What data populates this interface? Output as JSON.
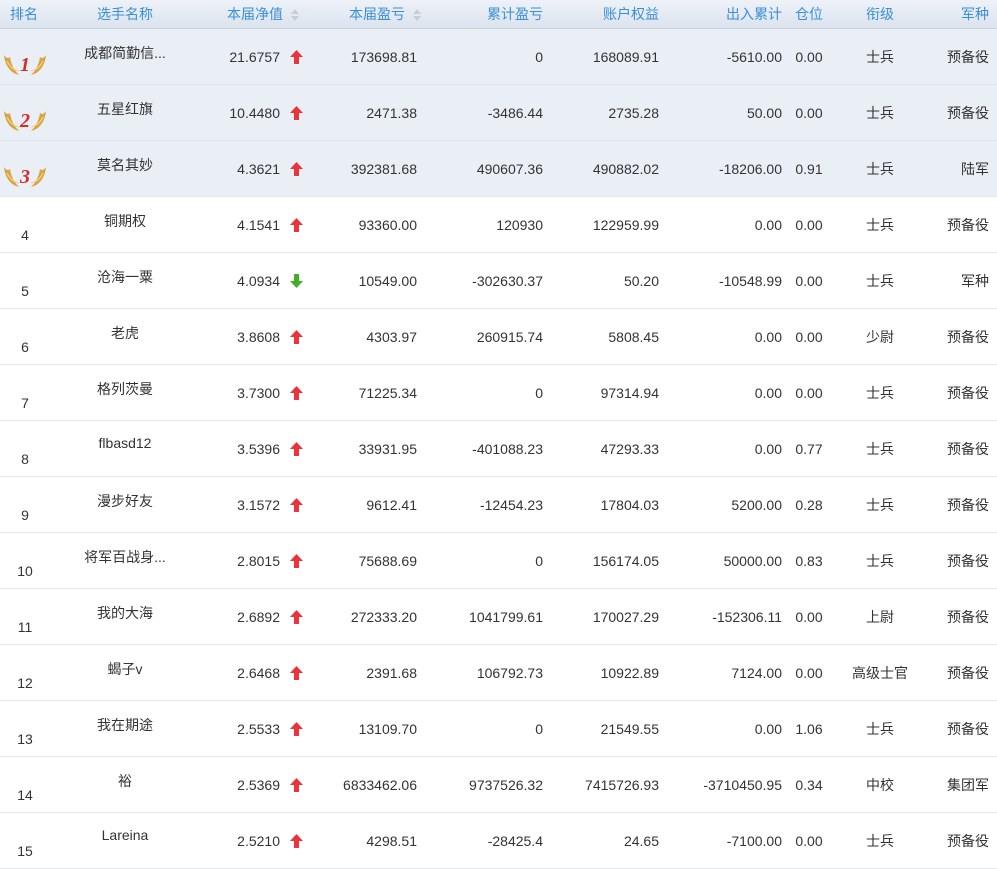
{
  "headers": {
    "rank": "排名",
    "name": "选手名称",
    "nav": "本届净值",
    "profit": "本届盈亏",
    "cumulative": "累计盈亏",
    "equity": "账户权益",
    "flow": "出入累计",
    "position": "仓位",
    "grade": "衔级",
    "branch": "军种"
  },
  "sortable_columns": [
    "nav",
    "profit"
  ],
  "colors": {
    "header_text": "#3a8fd6",
    "arrow_up": "#e8353b",
    "arrow_down": "#3fae29",
    "medal_gold": "#d9a441",
    "medal_number": "#d62b2b"
  },
  "rows": [
    {
      "rank": "1",
      "name": "成都简勤信...",
      "nav": "21.6757",
      "trend": "up",
      "profit": "173698.81",
      "cumulative": "0",
      "equity": "168089.91",
      "flow": "-5610.00",
      "position": "0.00",
      "grade": "士兵",
      "branch": "预备役"
    },
    {
      "rank": "2",
      "name": "五星红旗",
      "nav": "10.4480",
      "trend": "up",
      "profit": "2471.38",
      "cumulative": "-3486.44",
      "equity": "2735.28",
      "flow": "50.00",
      "position": "0.00",
      "grade": "士兵",
      "branch": "预备役"
    },
    {
      "rank": "3",
      "name": "莫名其妙",
      "nav": "4.3621",
      "trend": "up",
      "profit": "392381.68",
      "cumulative": "490607.36",
      "equity": "490882.02",
      "flow": "-18206.00",
      "position": "0.91",
      "grade": "士兵",
      "branch": "陆军"
    },
    {
      "rank": "4",
      "name": "铜期权",
      "nav": "4.1541",
      "trend": "up",
      "profit": "93360.00",
      "cumulative": "120930",
      "equity": "122959.99",
      "flow": "0.00",
      "position": "0.00",
      "grade": "士兵",
      "branch": "预备役"
    },
    {
      "rank": "5",
      "name": "沧海一粟",
      "nav": "4.0934",
      "trend": "down",
      "profit": "10549.00",
      "cumulative": "-302630.37",
      "equity": "50.20",
      "flow": "-10548.99",
      "position": "0.00",
      "grade": "士兵",
      "branch": "军种"
    },
    {
      "rank": "6",
      "name": "老虎",
      "nav": "3.8608",
      "trend": "up",
      "profit": "4303.97",
      "cumulative": "260915.74",
      "equity": "5808.45",
      "flow": "0.00",
      "position": "0.00",
      "grade": "少尉",
      "branch": "预备役"
    },
    {
      "rank": "7",
      "name": "格列茨曼",
      "nav": "3.7300",
      "trend": "up",
      "profit": "71225.34",
      "cumulative": "0",
      "equity": "97314.94",
      "flow": "0.00",
      "position": "0.00",
      "grade": "士兵",
      "branch": "预备役"
    },
    {
      "rank": "8",
      "name": "flbasd12",
      "nav": "3.5396",
      "trend": "up",
      "profit": "33931.95",
      "cumulative": "-401088.23",
      "equity": "47293.33",
      "flow": "0.00",
      "position": "0.77",
      "grade": "士兵",
      "branch": "预备役"
    },
    {
      "rank": "9",
      "name": "漫步好友",
      "nav": "3.1572",
      "trend": "up",
      "profit": "9612.41",
      "cumulative": "-12454.23",
      "equity": "17804.03",
      "flow": "5200.00",
      "position": "0.28",
      "grade": "士兵",
      "branch": "预备役"
    },
    {
      "rank": "10",
      "name": "将军百战身...",
      "nav": "2.8015",
      "trend": "up",
      "profit": "75688.69",
      "cumulative": "0",
      "equity": "156174.05",
      "flow": "50000.00",
      "position": "0.83",
      "grade": "士兵",
      "branch": "预备役"
    },
    {
      "rank": "11",
      "name": "我的大海",
      "nav": "2.6892",
      "trend": "up",
      "profit": "272333.20",
      "cumulative": "1041799.61",
      "equity": "170027.29",
      "flow": "-152306.11",
      "position": "0.00",
      "grade": "上尉",
      "branch": "预备役"
    },
    {
      "rank": "12",
      "name": "蝎子v",
      "nav": "2.6468",
      "trend": "up",
      "profit": "2391.68",
      "cumulative": "106792.73",
      "equity": "10922.89",
      "flow": "7124.00",
      "position": "0.00",
      "grade": "高级士官",
      "branch": "预备役"
    },
    {
      "rank": "13",
      "name": "我在期途",
      "nav": "2.5533",
      "trend": "up",
      "profit": "13109.70",
      "cumulative": "0",
      "equity": "21549.55",
      "flow": "0.00",
      "position": "1.06",
      "grade": "士兵",
      "branch": "预备役"
    },
    {
      "rank": "14",
      "name": "裕",
      "nav": "2.5369",
      "trend": "up",
      "profit": "6833462.06",
      "cumulative": "9737526.32",
      "equity": "7415726.93",
      "flow": "-3710450.95",
      "position": "0.34",
      "grade": "中校",
      "branch": "集团军"
    },
    {
      "rank": "15",
      "name": "Lareina",
      "nav": "2.5210",
      "trend": "up",
      "profit": "4298.51",
      "cumulative": "-28425.4",
      "equity": "24.65",
      "flow": "-7100.00",
      "position": "0.00",
      "grade": "士兵",
      "branch": "预备役"
    }
  ]
}
